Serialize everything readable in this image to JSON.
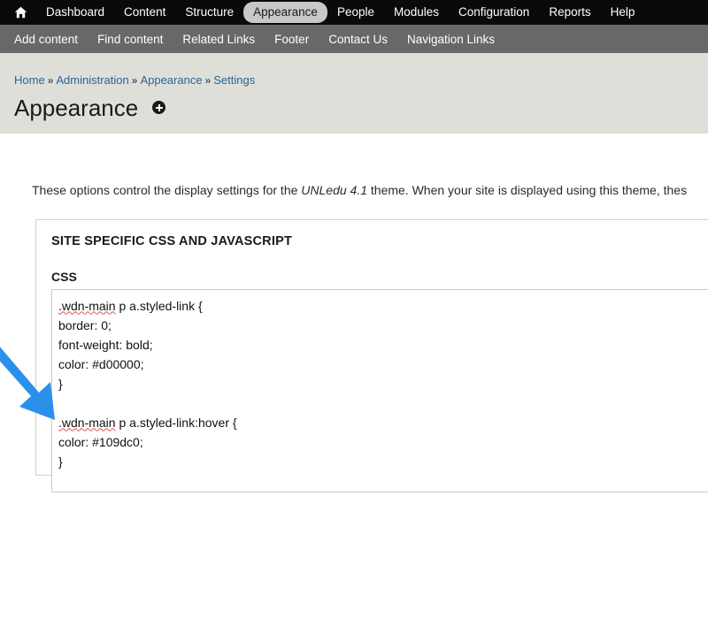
{
  "toolbar": {
    "home_icon": "home-icon",
    "items": [
      {
        "label": "Dashboard",
        "active": false
      },
      {
        "label": "Content",
        "active": false
      },
      {
        "label": "Structure",
        "active": false
      },
      {
        "label": "Appearance",
        "active": true
      },
      {
        "label": "People",
        "active": false
      },
      {
        "label": "Modules",
        "active": false
      },
      {
        "label": "Configuration",
        "active": false
      },
      {
        "label": "Reports",
        "active": false
      },
      {
        "label": "Help",
        "active": false
      }
    ]
  },
  "shortcut_bar": {
    "items": [
      {
        "label": "Add content"
      },
      {
        "label": "Find content"
      },
      {
        "label": "Related Links"
      },
      {
        "label": "Footer"
      },
      {
        "label": "Contact Us"
      },
      {
        "label": "Navigation Links"
      }
    ]
  },
  "page_head": {
    "breadcrumb": [
      {
        "label": "Home"
      },
      {
        "label": "Administration"
      },
      {
        "label": "Appearance"
      },
      {
        "label": "Settings"
      }
    ],
    "separator": "»",
    "title": "Appearance",
    "title_badge_icon": "plus-circle-icon"
  },
  "main": {
    "intro_before_em": "These options control the display settings for the ",
    "intro_em": "UNLedu 4.1",
    "intro_after_em": " theme. When your site is displayed using this theme, thes",
    "panel": {
      "title": "SITE SPECIFIC CSS AND JAVASCRIPT",
      "css_field": {
        "label": "CSS",
        "misspelled_token": ".wdn-main",
        "value_line_1_rest": " p a.styled-link {",
        "value_lines_mid": "border: 0;\nfont-weight: bold;\ncolor: #d00000;\n}\n\n",
        "value_line_7_rest": " p a.styled-link:hover {",
        "value_lines_end": "color: #109dc0;\n}"
      }
    }
  },
  "annotation": {
    "arrow_name": "blue-pointer-arrow",
    "arrow_color": "#2b8fec"
  },
  "colors": {
    "toolbar_bg": "#0a0a0a",
    "shortcut_bg": "#686868",
    "pagehead_bg": "#dfdfda",
    "link": "#2a6496",
    "accent_red": "#d00000",
    "accent_blue": "#109dc0",
    "arrow": "#2b8fec"
  }
}
